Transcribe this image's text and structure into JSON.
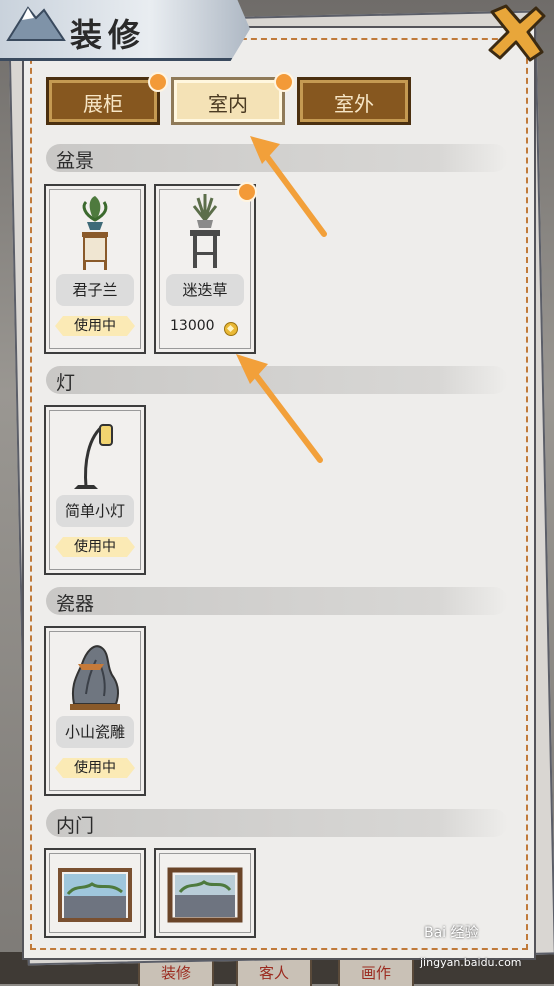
{
  "title": "装修",
  "tabs": [
    {
      "label": "展柜",
      "active": false,
      "has_dot": true
    },
    {
      "label": "室内",
      "active": true,
      "has_dot": true
    },
    {
      "label": "室外",
      "active": false,
      "has_dot": false
    }
  ],
  "sections": [
    {
      "label": "盆景",
      "items": [
        {
          "name": "君子兰",
          "status": "使用中"
        },
        {
          "name": "迷迭草",
          "price": "13000",
          "has_dot": true
        }
      ]
    },
    {
      "label": "灯",
      "items": [
        {
          "name": "简单小灯",
          "status": "使用中"
        }
      ]
    },
    {
      "label": "瓷器",
      "items": [
        {
          "name": "小山瓷雕",
          "status": "使用中"
        }
      ]
    },
    {
      "label": "内门",
      "items": [
        {
          "name": ""
        },
        {
          "name": ""
        }
      ]
    }
  ],
  "bottom_tabs": [
    "装修",
    "客人",
    "画作"
  ],
  "watermark": {
    "brand": "Bai 经验",
    "url": "jingyan.baidu.com"
  },
  "colors": {
    "accent_orange": "#f39a38",
    "tab_brown": "#86571f",
    "tab_light": "#f4e2b6"
  },
  "icons": [
    "close-x-icon",
    "mountain-emblem-icon",
    "coin-icon"
  ]
}
